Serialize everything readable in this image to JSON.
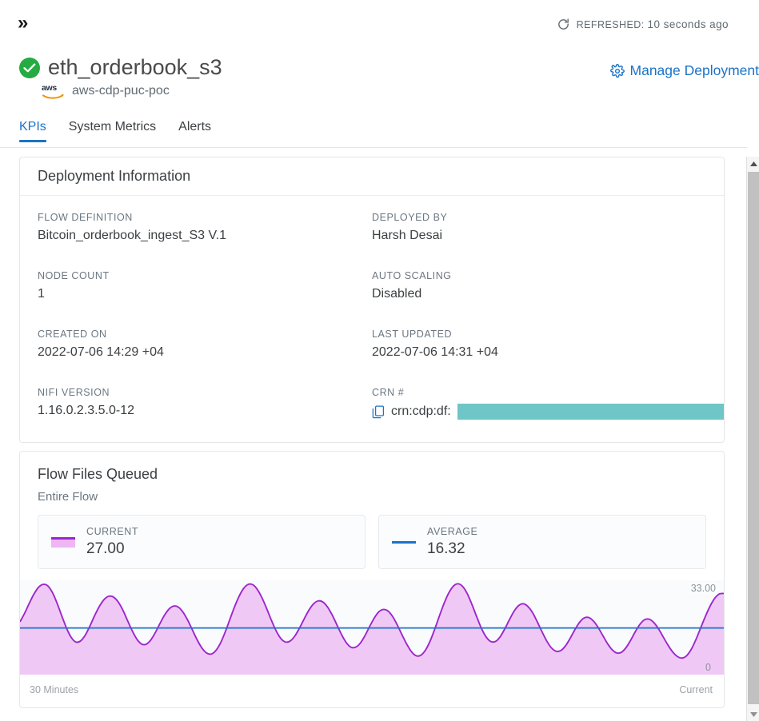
{
  "topbar": {
    "expand_icon": "double-chevron-right-icon",
    "refresh_icon": "refresh-icon",
    "refreshed_label": "REFRESHED:",
    "refreshed_value": "10 seconds ago"
  },
  "header": {
    "status_icon": "check-circle-icon",
    "deployment_name": "eth_orderbook_s3",
    "cloud_icon": "aws-logo-icon",
    "environment": "aws-cdp-puc-poc",
    "manage_icon": "gear-icon",
    "manage_label": "Manage Deployment"
  },
  "tabs": [
    {
      "label": "KPIs",
      "active": true
    },
    {
      "label": "System Metrics",
      "active": false
    },
    {
      "label": "Alerts",
      "active": false
    }
  ],
  "deployment_panel": {
    "title": "Deployment Information",
    "fields": [
      {
        "label": "FLOW DEFINITION",
        "value": "Bitcoin_orderbook_ingest_S3 V.1"
      },
      {
        "label": "DEPLOYED BY",
        "value": "Harsh Desai"
      },
      {
        "label": "NODE COUNT",
        "value": "1"
      },
      {
        "label": "AUTO SCALING",
        "value": "Disabled"
      },
      {
        "label": "CREATED ON",
        "value": "2022-07-06 14:29 +04"
      },
      {
        "label": "LAST UPDATED",
        "value": "2022-07-06 14:31 +04"
      },
      {
        "label": "NIFI VERSION",
        "value": "1.16.0.2.3.5.0-12"
      }
    ],
    "crn": {
      "label": "CRN #",
      "copy_icon": "copy-icon",
      "prefix": "crn:cdp:df:",
      "redacted": true,
      "redaction_color": "#6ec6c6"
    }
  },
  "flow_files_panel": {
    "title": "Flow Files Queued",
    "subtitle": "Entire Flow",
    "stats": [
      {
        "label": "CURRENT",
        "value": "27.00",
        "swatch": "area-fill-swatch",
        "color": "#9c27cc"
      },
      {
        "label": "AVERAGE",
        "value": "16.32",
        "swatch": "line-swatch",
        "color": "#1a73c8"
      }
    ]
  },
  "chart_data": {
    "type": "area",
    "title": "Flow Files Queued",
    "subtitle": "Entire Flow",
    "xlabel": "",
    "ylabel": "",
    "ylim": [
      0,
      33
    ],
    "y_max_label": "33.00",
    "y_min_label": "0",
    "x_start_label": "30 Minutes",
    "x_end_label": "Current",
    "grid": false,
    "legend": [
      "Current",
      "Average"
    ],
    "legend_position": "above-chart",
    "series": [
      {
        "name": "Current",
        "type": "area",
        "line_color": "#9c27cc",
        "fill_color": "#f0c8f5",
        "values": [
          18.5,
          21.5,
          25.0,
          28.2,
          30.6,
          31.6,
          31.0,
          28.6,
          24.8,
          20.4,
          16.2,
          13.0,
          11.4,
          11.8,
          13.8,
          17.0,
          20.6,
          23.8,
          26.2,
          27.4,
          27.2,
          25.6,
          22.8,
          19.2,
          15.6,
          12.6,
          10.8,
          10.6,
          12.0,
          14.6,
          17.8,
          20.8,
          23.0,
          24.0,
          23.6,
          21.8,
          19.0,
          15.6,
          12.2,
          9.4,
          7.6,
          7.2,
          8.4,
          11.0,
          14.8,
          19.2,
          23.6,
          27.4,
          30.2,
          31.6,
          31.4,
          29.6,
          26.6,
          22.8,
          18.8,
          15.2,
          12.6,
          11.4,
          11.8,
          13.6,
          16.4,
          19.6,
          22.6,
          24.8,
          25.8,
          25.4,
          23.6,
          20.8,
          17.4,
          14.0,
          11.2,
          9.6,
          9.6,
          11.0,
          13.6,
          16.8,
          19.8,
          22.0,
          22.8,
          22.2,
          20.2,
          17.2,
          13.8,
          10.6,
          8.0,
          6.6,
          6.8,
          8.6,
          11.8,
          16.0,
          20.6,
          25.0,
          28.6,
          31.0,
          31.8,
          30.8,
          28.2,
          24.4,
          20.2,
          16.2,
          13.2,
          11.6,
          11.6,
          13.2,
          16.0,
          19.2,
          22.2,
          24.2,
          24.8,
          23.8,
          21.6,
          18.4,
          15.0,
          11.8,
          9.4,
          8.2,
          8.4,
          10.0,
          12.6,
          15.6,
          18.2,
          19.8,
          20.0,
          18.8,
          16.6,
          13.8,
          11.0,
          8.8,
          7.6,
          7.8,
          9.4,
          12.0,
          15.0,
          17.6,
          19.2,
          19.4,
          18.2,
          16.0,
          13.2,
          10.4,
          8.0,
          6.4,
          5.8,
          6.6,
          8.8,
          12.2,
          16.2,
          20.2,
          23.8,
          26.6,
          28.2,
          28.4
        ]
      },
      {
        "name": "Average",
        "type": "line",
        "line_color": "#1a73c8",
        "constant_value": 16.32
      }
    ]
  },
  "scrollbar": {
    "up_icon": "scroll-up-arrow-icon",
    "down_icon": "scroll-down-arrow-icon"
  }
}
